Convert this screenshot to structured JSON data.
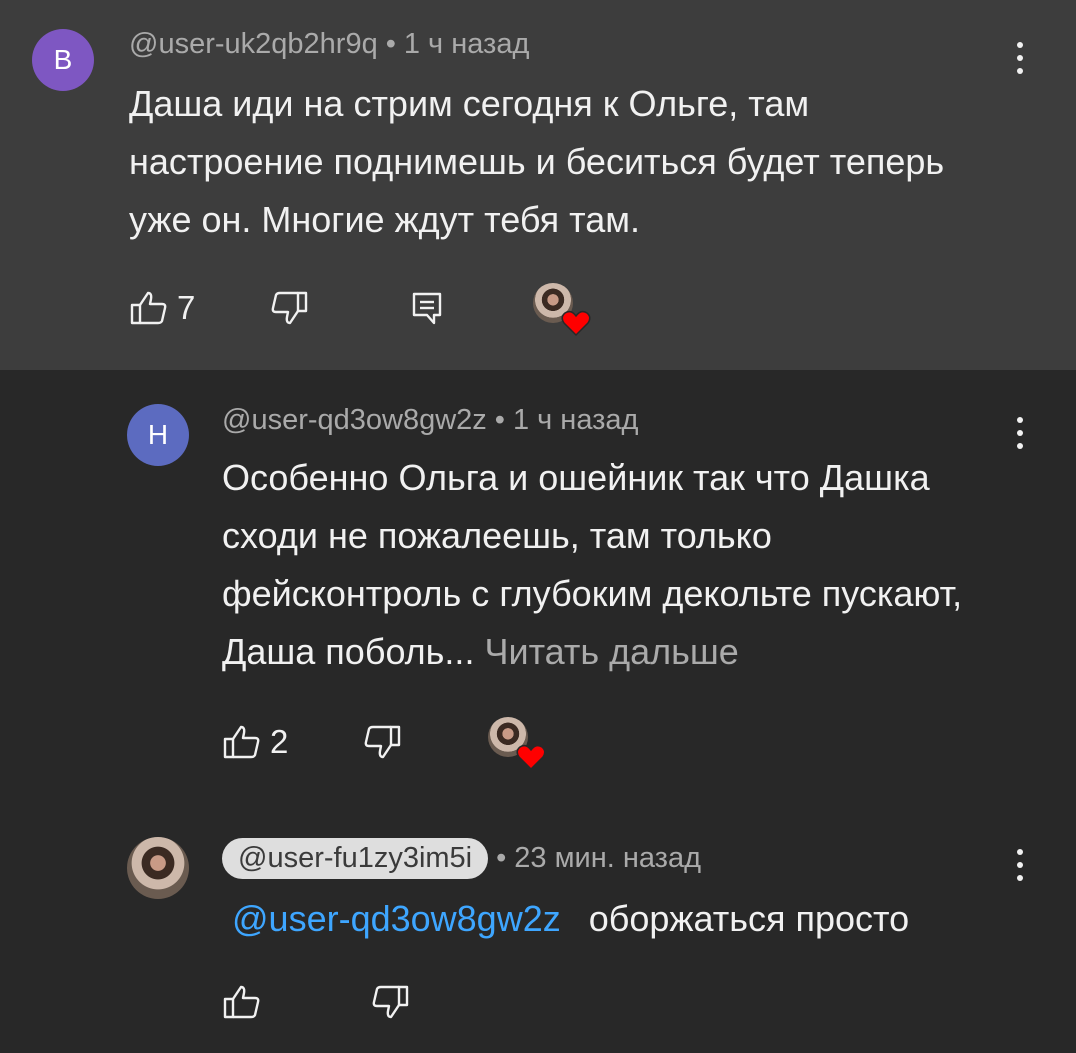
{
  "comments": [
    {
      "avatar_letter": "B",
      "author": "@user-uk2qb2hr9q",
      "time": "1 ч назад",
      "text": "Даша иди на стрим сегодня к Ольге, там настроение поднимешь и беситься будет теперь уже он. Многие ждут тебя там.",
      "likes": "7",
      "avatar_color": "#7e57c2"
    },
    {
      "avatar_letter": "Н",
      "author": "@user-qd3ow8gw2z",
      "time": "1 ч назад",
      "text": "Особенно Ольга и ошейник так что Дашка сходи не пожалеешь, там только фейсконтроль с глубоким декольте пускают, Даша поболь...",
      "read_more": "Читать дальше",
      "likes": "2",
      "avatar_color": "#5c6bc0"
    },
    {
      "author": "@user-fu1zy3im5i",
      "time": "23 мин. назад",
      "mention": "@user-qd3ow8gw2z",
      "text": "оборжаться просто"
    }
  ],
  "icons": {
    "like": "thumb-up-icon",
    "dislike": "thumb-down-icon",
    "reply": "reply-icon",
    "more": "more-vertical-icon",
    "creator_heart": "heart-icon"
  },
  "colors": {
    "highlight_bg": "#3d3d3d",
    "page_bg": "#282828",
    "mention": "#3ea6ff",
    "heart": "#ff0000"
  }
}
